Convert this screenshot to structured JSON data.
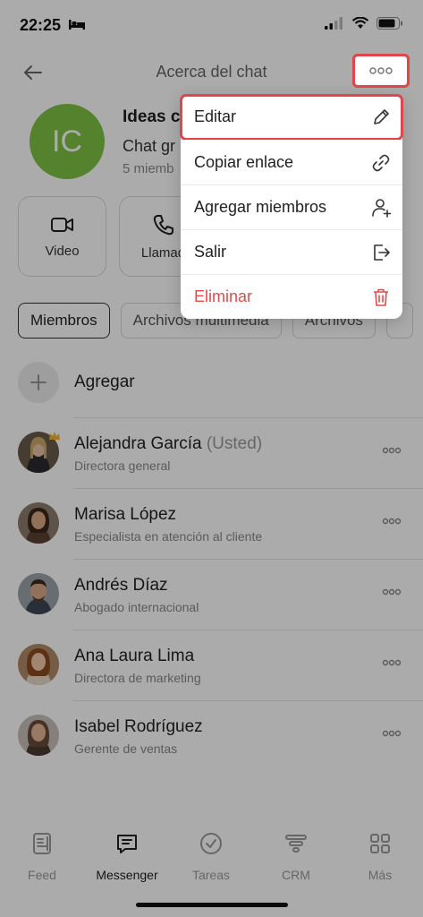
{
  "status": {
    "time": "22:25"
  },
  "nav": {
    "title": "Acerca del chat"
  },
  "chat": {
    "initials": "IC",
    "name": "Ideas c",
    "type": "Chat gr",
    "members": "5 miemb",
    "avatar_color": "#7fc242"
  },
  "actions": [
    {
      "label": "Video",
      "icon": "video-icon"
    },
    {
      "label": "Llamad",
      "icon": "phone-icon"
    }
  ],
  "tabs": [
    "Miembros",
    "Archivos multimedia",
    "Archivos"
  ],
  "members": {
    "add_label": "Agregar",
    "list": [
      {
        "name": "Alejandra García",
        "suffix": "(Usted)",
        "role": "Directora general"
      },
      {
        "name": "Marisa López",
        "suffix": "",
        "role": "Especialista en atención al cliente"
      },
      {
        "name": "Andrés Díaz",
        "suffix": "",
        "role": "Abogado internacional"
      },
      {
        "name": "Ana Laura Lima",
        "suffix": "",
        "role": "Directora de marketing"
      },
      {
        "name": "Isabel Rodríguez",
        "suffix": "",
        "role": "Gerente de ventas"
      }
    ]
  },
  "menu": {
    "items": [
      {
        "label": "Editar",
        "icon": "pencil-icon"
      },
      {
        "label": "Copiar enlace",
        "icon": "link-icon"
      },
      {
        "label": "Agregar miembros",
        "icon": "add-user-icon"
      },
      {
        "label": "Salir",
        "icon": "exit-icon"
      },
      {
        "label": "Eliminar",
        "icon": "trash-icon"
      }
    ],
    "danger_color": "#e44a4a"
  },
  "tabbar": {
    "items": [
      {
        "label": "Feed",
        "icon": "feed-icon"
      },
      {
        "label": "Messenger",
        "icon": "chat-bubble-icon"
      },
      {
        "label": "Tareas",
        "icon": "check-circle-icon"
      },
      {
        "label": "CRM",
        "icon": "funnel-icon"
      },
      {
        "label": "Más",
        "icon": "grid-icon"
      }
    ]
  },
  "colors": {
    "highlight": "#e0474c"
  }
}
